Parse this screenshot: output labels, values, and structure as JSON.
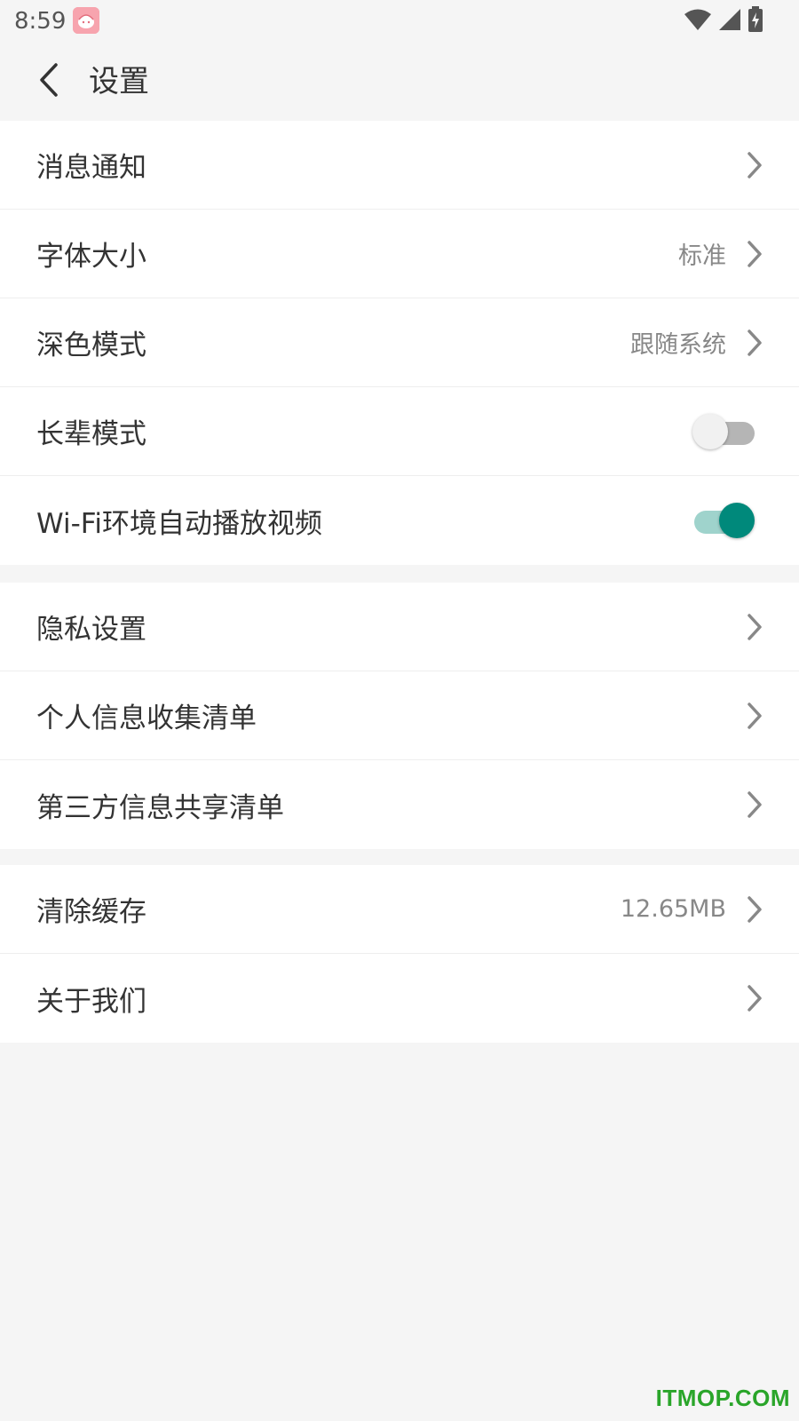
{
  "status_bar": {
    "time": "8:59",
    "icons": [
      "app-notification-icon",
      "wifi-icon",
      "cellular-signal-icon",
      "battery-charging-icon"
    ]
  },
  "header": {
    "title": "设置",
    "back_icon": "chevron-left-icon"
  },
  "groups": [
    {
      "items": [
        {
          "label": "消息通知",
          "type": "link"
        },
        {
          "label": "字体大小",
          "type": "link",
          "value": "标准"
        },
        {
          "label": "深色模式",
          "type": "link",
          "value": "跟随系统"
        },
        {
          "label": "长辈模式",
          "type": "toggle",
          "on": false
        },
        {
          "label": "Wi-Fi环境自动播放视频",
          "type": "toggle",
          "on": true
        }
      ]
    },
    {
      "items": [
        {
          "label": "隐私设置",
          "type": "link"
        },
        {
          "label": "个人信息收集清单",
          "type": "link"
        },
        {
          "label": "第三方信息共享清单",
          "type": "link"
        }
      ]
    },
    {
      "items": [
        {
          "label": "清除缓存",
          "type": "link",
          "value": "12.65MB"
        },
        {
          "label": "关于我们",
          "type": "link"
        }
      ]
    }
  ],
  "colors": {
    "accent": "#00897b",
    "accent_track": "#9fd3cc",
    "background": "#f5f5f5",
    "text": "#333333",
    "secondary_text": "#888888"
  },
  "watermark": "ITMOP.COM"
}
